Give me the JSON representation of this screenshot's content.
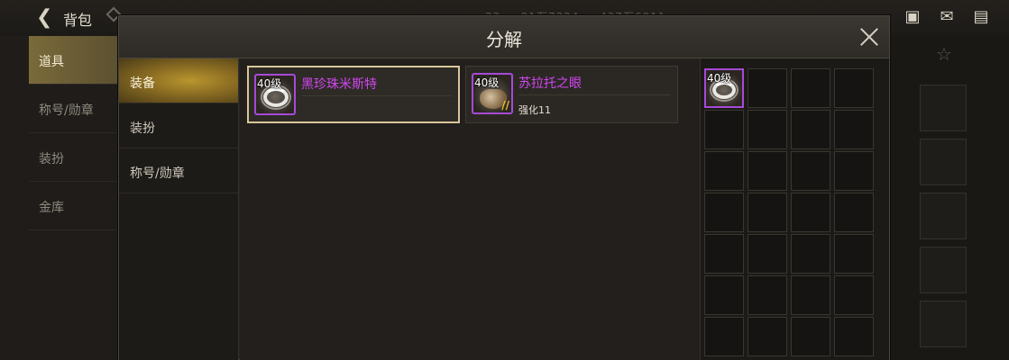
{
  "background": {
    "title": "背包",
    "stats": "… 33 … 21万7324 … 437万6911 …",
    "left_nav": [
      {
        "label": "道具",
        "active": true
      },
      {
        "label": "称号/勋章",
        "active": false
      },
      {
        "label": "装扮",
        "active": false
      },
      {
        "label": "金库",
        "active": false
      }
    ],
    "top_icons": [
      "gift-icon",
      "mail-icon",
      "chat-icon"
    ]
  },
  "modal": {
    "title": "分解",
    "side_tabs": [
      {
        "label": "装备",
        "active": true
      },
      {
        "label": "装扮",
        "active": false
      },
      {
        "label": "称号/勋章",
        "active": false
      }
    ],
    "items": [
      {
        "level": "40级",
        "name": "黑珍珠米斯特",
        "sub": "",
        "selected": true,
        "icon": "ring-icon"
      },
      {
        "level": "40级",
        "name": "苏拉托之眼",
        "sub": "强化11",
        "selected": false,
        "icon": "orb-icon"
      }
    ],
    "grid": {
      "columns": 4,
      "rows": 7,
      "filled": [
        {
          "index": 0,
          "level": "40级",
          "icon": "ring-icon"
        }
      ]
    }
  },
  "colors": {
    "item_name": "#d146f0",
    "rarity_border": "#a64ad6",
    "active_tab": "#b9962f"
  }
}
